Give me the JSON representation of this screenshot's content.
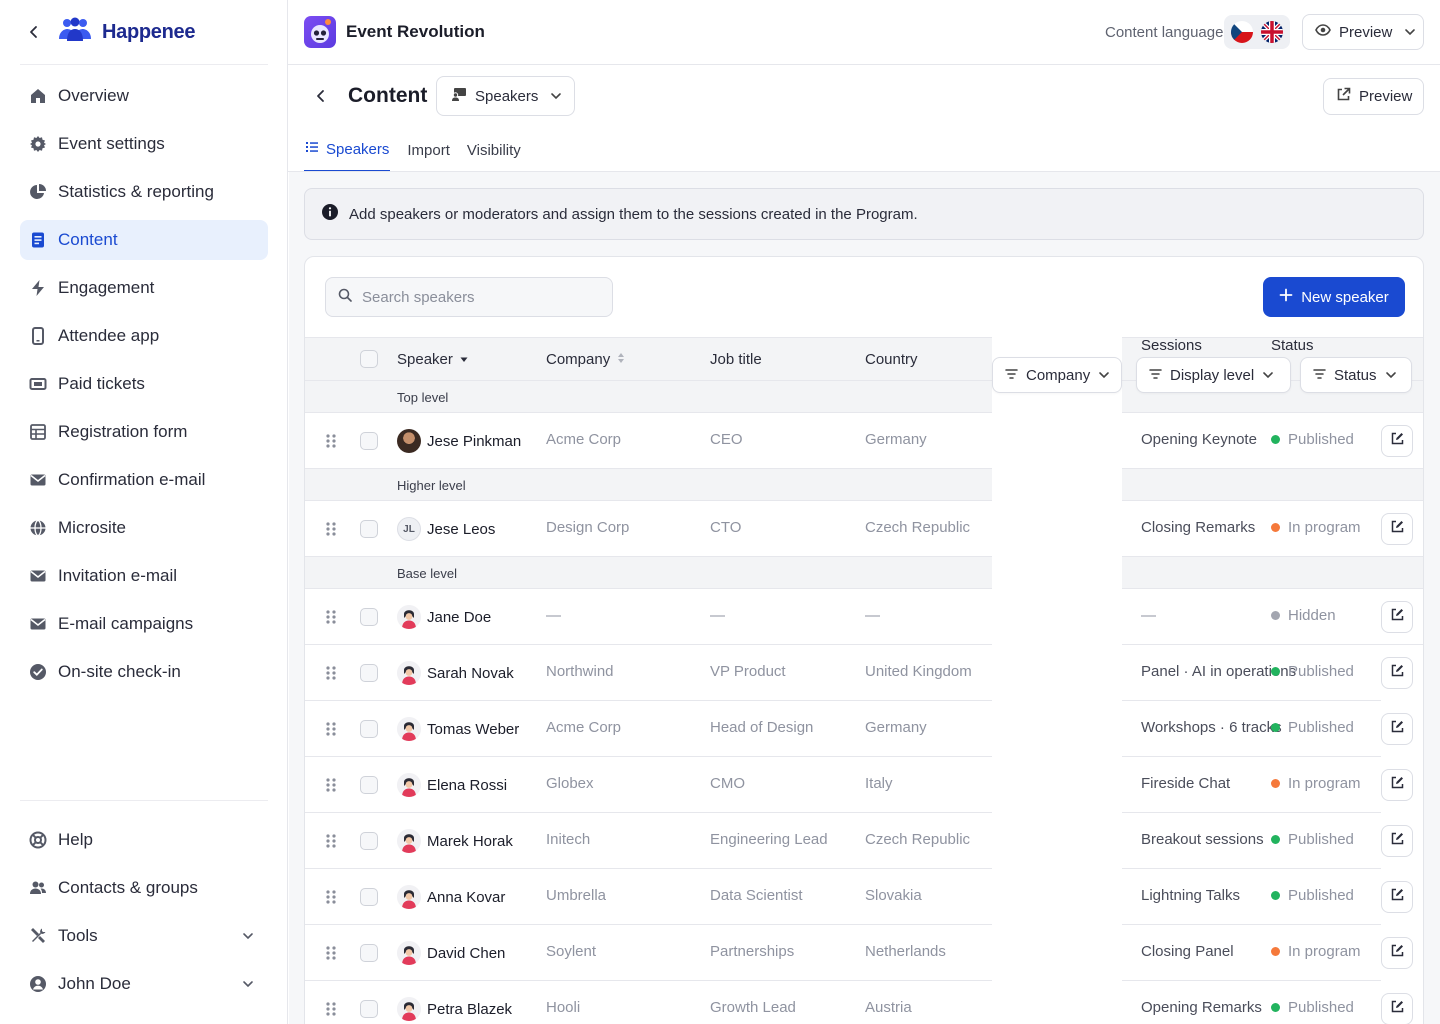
{
  "brand": {
    "name": "Happenee"
  },
  "nav": [
    {
      "label": "Overview",
      "icon": "home-icon"
    },
    {
      "label": "Event settings",
      "icon": "gear-icon"
    },
    {
      "label": "Statistics & reporting",
      "icon": "pie-chart-icon"
    },
    {
      "label": "Content",
      "icon": "document-icon",
      "active": true
    },
    {
      "label": "Engagement",
      "icon": "bolt-icon"
    },
    {
      "label": "Attendee app",
      "icon": "phone-icon"
    },
    {
      "label": "Paid tickets",
      "icon": "ticket-icon"
    },
    {
      "label": "Registration form",
      "icon": "form-icon"
    },
    {
      "label": "Confirmation e-mail",
      "icon": "mail-icon"
    },
    {
      "label": "Microsite",
      "icon": "globe-icon"
    },
    {
      "label": "Invitation e-mail",
      "icon": "mail-icon"
    },
    {
      "label": "E-mail campaigns",
      "icon": "mail-icon"
    },
    {
      "label": "On-site check-in",
      "icon": "check-circle-icon"
    }
  ],
  "nav_bottom": [
    {
      "label": "Help",
      "icon": "lifebuoy-icon"
    },
    {
      "label": "Contacts & groups",
      "icon": "users-icon"
    },
    {
      "label": "Tools",
      "icon": "tools-icon",
      "expandable": true
    },
    {
      "label": "John Doe",
      "icon": "user-icon",
      "expandable": true
    }
  ],
  "topbar": {
    "event_title": "Event Revolution",
    "content_language_label": "Content language",
    "preview_label": "Preview"
  },
  "content": {
    "title": "Content",
    "section_select": "Speakers",
    "preview_label": "Preview",
    "tabs": [
      "Speakers",
      "Import",
      "Visibility"
    ],
    "info_text": "Add speakers or moderators and assign them to the sessions created in the Program."
  },
  "toolbar": {
    "search_placeholder": "Search speakers",
    "new_button": "New speaker"
  },
  "table": {
    "headers": {
      "speaker": "Speaker",
      "company": "Company",
      "job_title": "Job title",
      "country": "Country",
      "sessions": "Sessions",
      "status": "Status"
    },
    "filters": [
      "Company",
      "Display level",
      "Status"
    ],
    "groups": [
      "Top level",
      "Higher level",
      "Base level"
    ],
    "rows": [
      {
        "name": "Jese Pinkman",
        "company": "Acme Corp",
        "job": "CEO",
        "country": "Germany",
        "session": "Opening Keynote",
        "status": "Published",
        "avatar": "photo"
      },
      {
        "name": "Jese Leos",
        "company": "Design Corp",
        "job": "CTO",
        "country": "Czech Republic",
        "session": "Closing Remarks",
        "status": "In program",
        "avatar": "initials",
        "initials": "JL"
      },
      {
        "name": "Jane Doe",
        "company": "—",
        "job": "—",
        "country": "—",
        "session": "—",
        "status": "Hidden",
        "avatar": "illustration"
      },
      {
        "name": "Sarah Novak",
        "company": "Northwind",
        "job": "VP Product",
        "country": "United Kingdom",
        "session": "Panel · AI in operations",
        "status": "Published",
        "avatar": "illustration"
      },
      {
        "name": "Tomas Weber",
        "company": "Acme Corp",
        "job": "Head of Design",
        "country": "Germany",
        "session": "Workshops · 6 tracks",
        "status": "Published",
        "avatar": "illustration"
      },
      {
        "name": "Elena Rossi",
        "company": "Globex",
        "job": "CMO",
        "country": "Italy",
        "session": "Fireside Chat",
        "status": "In program",
        "avatar": "illustration"
      },
      {
        "name": "Marek Horak",
        "company": "Initech",
        "job": "Engineering Lead",
        "country": "Czech Republic",
        "session": "Breakout sessions",
        "status": "Published",
        "avatar": "illustration"
      },
      {
        "name": "Anna Kovar",
        "company": "Umbrella",
        "job": "Data Scientist",
        "country": "Slovakia",
        "session": "Lightning Talks",
        "status": "Published",
        "avatar": "illustration"
      },
      {
        "name": "David Chen",
        "company": "Soylent",
        "job": "Partnerships",
        "country": "Netherlands",
        "session": "Closing Panel",
        "status": "In program",
        "avatar": "illustration"
      },
      {
        "name": "Petra Blazek",
        "company": "Hooli",
        "job": "Growth Lead",
        "country": "Austria",
        "session": "Opening Remarks",
        "status": "Published",
        "avatar": "illustration"
      }
    ]
  },
  "colors": {
    "accent": "#1a4ad1",
    "published": "#22b35e",
    "in_program": "#f5793b",
    "hidden": "#a3a6b0"
  }
}
